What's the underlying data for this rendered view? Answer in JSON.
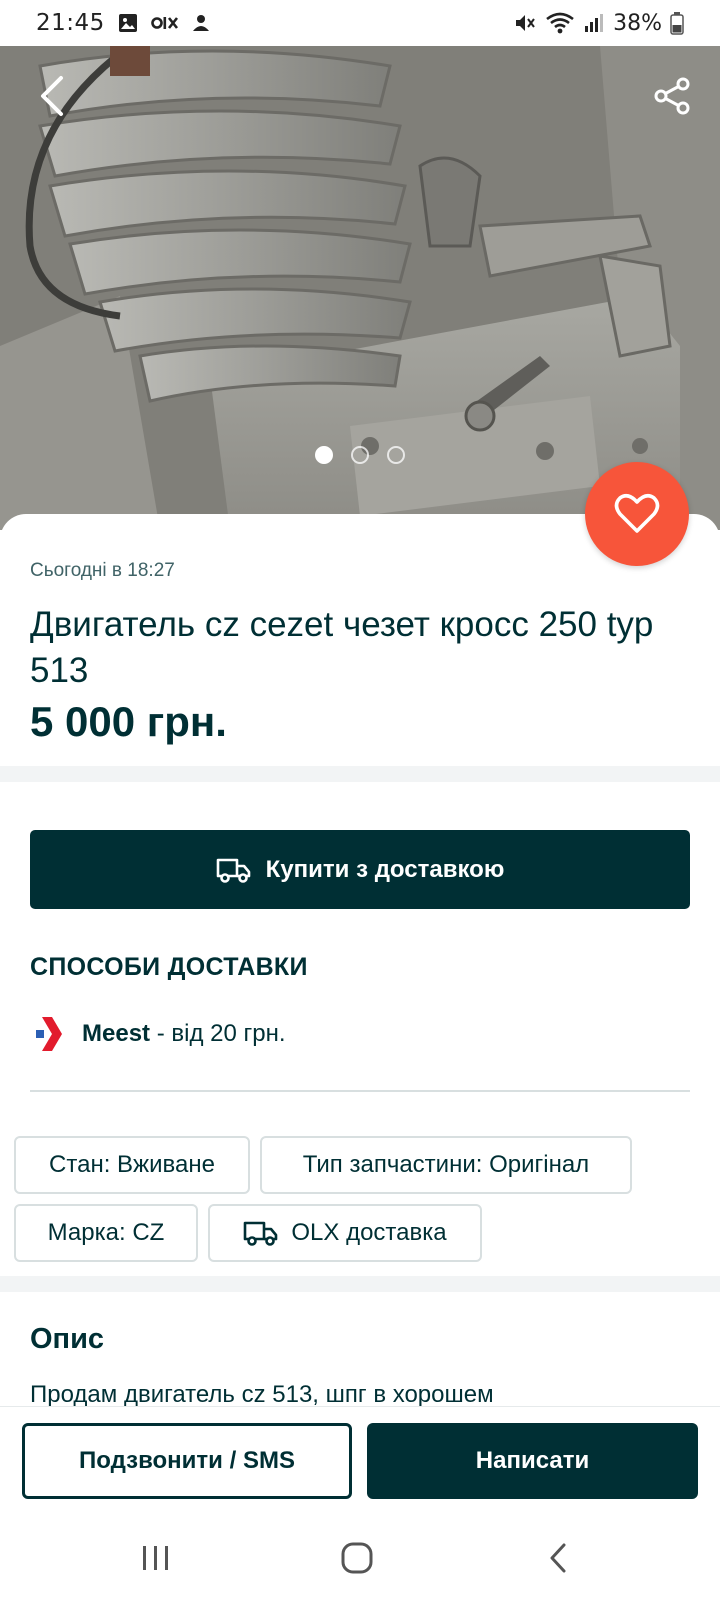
{
  "status_bar": {
    "time": "21:45",
    "battery": "38%",
    "icons": [
      "gallery-icon",
      "olx-icon",
      "person-icon",
      "mute-icon",
      "wifi-icon",
      "signal-icon",
      "battery-icon"
    ]
  },
  "gallery": {
    "image_count": 3,
    "active_index": 0
  },
  "listing": {
    "posted": "Сьогодні в 18:27",
    "title": "Двигатель cz cezet чезет кросс 250 typ 513",
    "price": "5 000 грн."
  },
  "buy": {
    "label": "Купити з доставкою"
  },
  "delivery": {
    "heading": "СПОСОБИ ДОСТАВКИ",
    "methods": [
      {
        "name": "Meest",
        "price": " - від 20 грн."
      }
    ]
  },
  "params": [
    {
      "label": "Стан: Вживане"
    },
    {
      "label": "Тип запчастини: Оригінал"
    },
    {
      "label": "Марка: CZ"
    },
    {
      "label": "OLX доставка"
    }
  ],
  "description": {
    "heading": "Опис",
    "text": "Продам двигатель cz 513, шпг в хорошем"
  },
  "actions": {
    "call_label": "Подзвонити / SMS",
    "write_label": "Написати"
  },
  "colors": {
    "primary": "#002f34",
    "favorite": "#f7553a",
    "separator": "#f2f4f5"
  }
}
